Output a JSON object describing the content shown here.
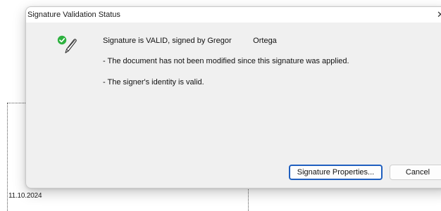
{
  "background": {
    "date": "11.10.2024"
  },
  "dialog": {
    "title": "Signature Validation Status",
    "close_glyph": "✕",
    "status_icon": "valid-signature-icon",
    "messages": {
      "line1": "Signature is VALID, signed by Gregor          Ortega",
      "line2": "- The document has not been modified since this signature was applied.",
      "line3": "- The signer's identity is valid."
    },
    "buttons": {
      "properties": "Signature Properties...",
      "cancel": "Cancel"
    }
  },
  "colors": {
    "check_green": "#2db13f",
    "primary_border": "#1f5fbf"
  }
}
